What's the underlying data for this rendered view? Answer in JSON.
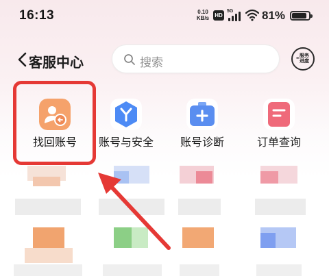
{
  "status_bar": {
    "time": "16:13",
    "net_speed_value": "0.10",
    "net_speed_unit": "KB/s",
    "hd_badge": "HD",
    "signal_label": "5G",
    "battery_percent": "81%",
    "battery_level": 0.81
  },
  "header": {
    "title": "客服中心",
    "back_icon": "chevron-left-icon",
    "search_placeholder": "搜索",
    "progress_label_top": "服务",
    "progress_label_bottom": "进度"
  },
  "shortcuts": [
    {
      "label": "找回账号",
      "icon": "account-recover-icon",
      "color": "#f5a26b",
      "highlighted": true
    },
    {
      "label": "账号与安全",
      "icon": "account-security-icon",
      "color": "#4d8bf5",
      "highlighted": false
    },
    {
      "label": "账号诊断",
      "icon": "account-diagnosis-icon",
      "color": "#5a8ef0",
      "highlighted": false
    },
    {
      "label": "订单查询",
      "icon": "order-query-icon",
      "color": "#ef6a7a",
      "highlighted": false
    }
  ],
  "colors": {
    "highlight": "#e53935",
    "accent_orange": "#f5a26b",
    "accent_blue": "#4d8bf5",
    "accent_red": "#ef6a7a"
  }
}
